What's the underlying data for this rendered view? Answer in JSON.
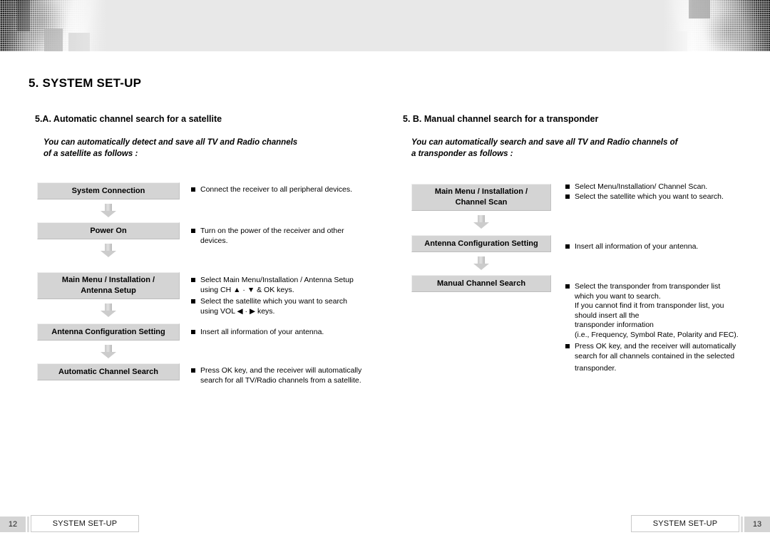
{
  "document": {
    "title": "5. SYSTEM SET-UP"
  },
  "sections": {
    "left": {
      "heading": "5.A. Automatic channel search for a satellite",
      "intro_line1": "You can automatically detect and save all TV and Radio channels",
      "intro_line2": " of a satellite as follows :",
      "steps": [
        {
          "label_line1": "System Connection",
          "label_line2": ""
        },
        {
          "label_line1": "Power On",
          "label_line2": ""
        },
        {
          "label_line1": "Main Menu / Installation /",
          "label_line2": "Antenna Setup"
        },
        {
          "label_line1": "Antenna Configuration Setting",
          "label_line2": ""
        },
        {
          "label_line1": "Automatic Channel Search",
          "label_line2": ""
        }
      ],
      "notes": [
        {
          "line1": "Connect the receiver to all peripheral devices.",
          "line2": "",
          "line3": "",
          "line4": "",
          "line5": "",
          "line6": ""
        },
        {
          "line1": "Turn on the power of the receiver and other",
          "line2": "devices.",
          "line3": "",
          "line4": "",
          "line5": "",
          "line6": ""
        },
        {
          "line1": "Select Main Menu/Installation / Antenna Setup",
          "line2": "using CH ▲ · ▼ & OK keys.",
          "line3": "",
          "line4": "",
          "line5": "",
          "line6": ""
        },
        {
          "line1": "Select the satellite which you want to search",
          "line2": "using VOL ◀ · ▶ keys.",
          "line3": "",
          "line4": "",
          "line5": "",
          "line6": ""
        },
        {
          "line1": "Insert all information of your antenna.",
          "line2": "",
          "line3": "",
          "line4": "",
          "line5": "",
          "line6": ""
        },
        {
          "line1": "Press OK key, and the receiver will automatically",
          "line2": "search for all TV/Radio channels from a satellite.",
          "line3": "",
          "line4": "",
          "line5": "",
          "line6": ""
        }
      ]
    },
    "right": {
      "heading": "5. B. Manual channel search for a transponder",
      "intro_line1": "You can automatically search and save all TV and Radio channels of",
      "intro_line2": "a transponder as follows :",
      "steps": [
        {
          "label_line1": "Main Menu / Installation /",
          "label_line2": "Channel Scan"
        },
        {
          "label_line1": "Antenna Configuration Setting",
          "label_line2": ""
        },
        {
          "label_line1": "Manual Channel Search",
          "label_line2": ""
        }
      ],
      "notes": [
        {
          "line1": "Select Menu/Installation/ Channel Scan.",
          "line2": "",
          "line3": "",
          "line4": "",
          "line5": "",
          "line6": ""
        },
        {
          "line1": "Select the satellite which you want to search.",
          "line2": "",
          "line3": "",
          "line4": "",
          "line5": "",
          "line6": ""
        },
        {
          "line1": "Insert all information of your antenna.",
          "line2": "",
          "line3": "",
          "line4": "",
          "line5": "",
          "line6": ""
        },
        {
          "line1": "Select the transponder from transponder list",
          "line2": "which you want to search.",
          "line3": "If you cannot find it from transponder list, you",
          "line4": "should insert all the",
          "line5": "transponder information",
          "line6": "(i.e., Frequency, Symbol Rate, Polarity and FEC)."
        },
        {
          "line1": "Press OK key, and the receiver will automatically",
          "line2": "search for all channels contained in the selected",
          "line3": "transponder.",
          "line4": "",
          "line5": "",
          "line6": ""
        }
      ]
    }
  },
  "footer": {
    "left_page_number": "12",
    "left_label": "SYSTEM SET-UP",
    "right_label": "SYSTEM SET-UP",
    "right_page_number": "13"
  }
}
